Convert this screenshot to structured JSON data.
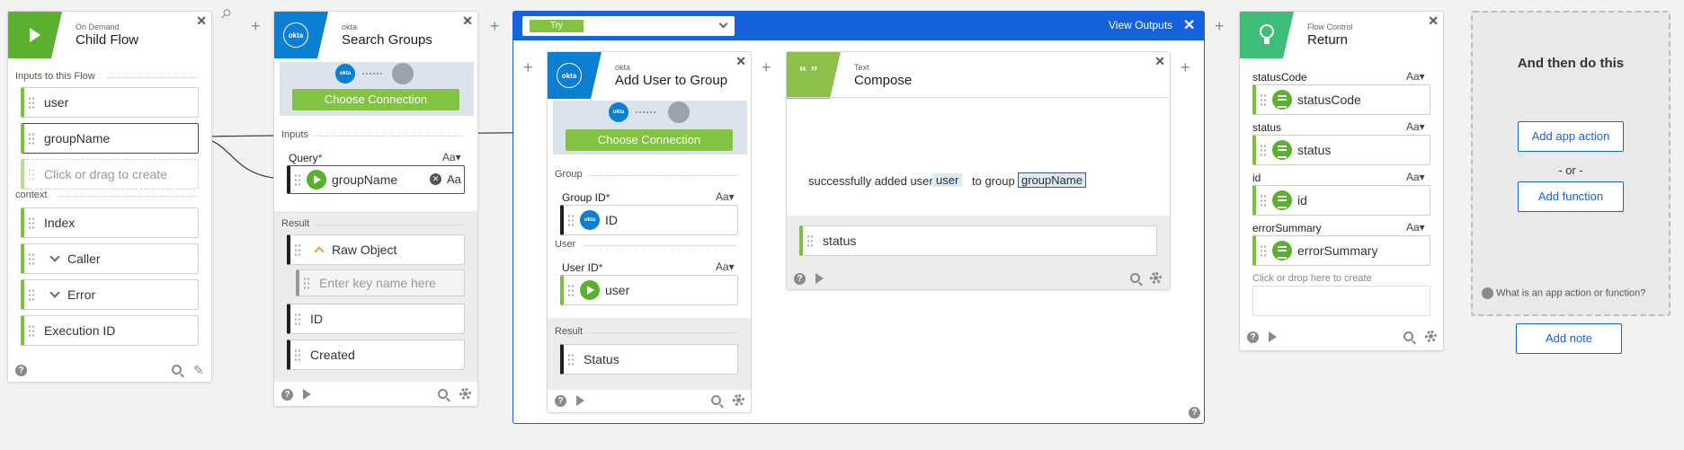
{
  "child_flow": {
    "app": "On Demand",
    "title": "Child Flow",
    "inputs_label": "Inputs to this Flow",
    "inputs": [
      "user",
      "groupName"
    ],
    "create_placeholder": "Click or drag to create",
    "context_label": "context",
    "context_items": [
      "Index",
      "Caller",
      "Error",
      "Execution ID"
    ]
  },
  "search_groups": {
    "app": "okta",
    "title": "Search Groups",
    "okta_icon_text": "okta",
    "choose_connection": "Choose Connection",
    "inputs_label": "Inputs",
    "query_label": "Query",
    "required_mark": "*",
    "type_toggle": "Aa▾",
    "query_value": "groupName",
    "query_type": "Aa",
    "result_label": "Result",
    "results": [
      "Raw Object",
      "ID",
      "Created"
    ],
    "key_placeholder": "Enter key name here"
  },
  "try_block": {
    "selected": "Try",
    "view_outputs": "View Outputs"
  },
  "add_user": {
    "app": "okta",
    "title": "Add User to Group",
    "choose_connection": "Choose Connection",
    "group_section": "Group",
    "group_id_label": "Group ID",
    "group_id_value": "ID",
    "user_section": "User",
    "user_id_label": "User ID",
    "user_id_value": "user",
    "type_toggle": "Aa▾",
    "required_mark": "*",
    "result_label": "Result",
    "result_value": "Status"
  },
  "compose": {
    "app": "Text",
    "title": "Compose",
    "icon_text": "“ ”",
    "text_before": "successfully added user",
    "token_user": "user",
    "text_middle": "to group",
    "token_group": "groupName",
    "output": "status"
  },
  "return_card": {
    "app": "Flow Control",
    "title": "Return",
    "type_toggle": "Aa▾",
    "fields": [
      {
        "label": "statusCode",
        "value": "statusCode"
      },
      {
        "label": "status",
        "value": "status"
      },
      {
        "label": "id",
        "value": "id"
      },
      {
        "label": "errorSummary",
        "value": "errorSummary"
      }
    ],
    "drop_hint": "Click or drop here to create"
  },
  "then_panel": {
    "title": "And then do this",
    "add_app_action": "Add app action",
    "or": "- or -",
    "add_function": "Add function",
    "help_text": "What is an app action or function?",
    "add_note": "Add note"
  },
  "colors": {
    "green": "#5bb12f",
    "okta_blue": "#0b7fd1",
    "try_blue": "#1662dd",
    "control_green": "#3dbf7a"
  }
}
